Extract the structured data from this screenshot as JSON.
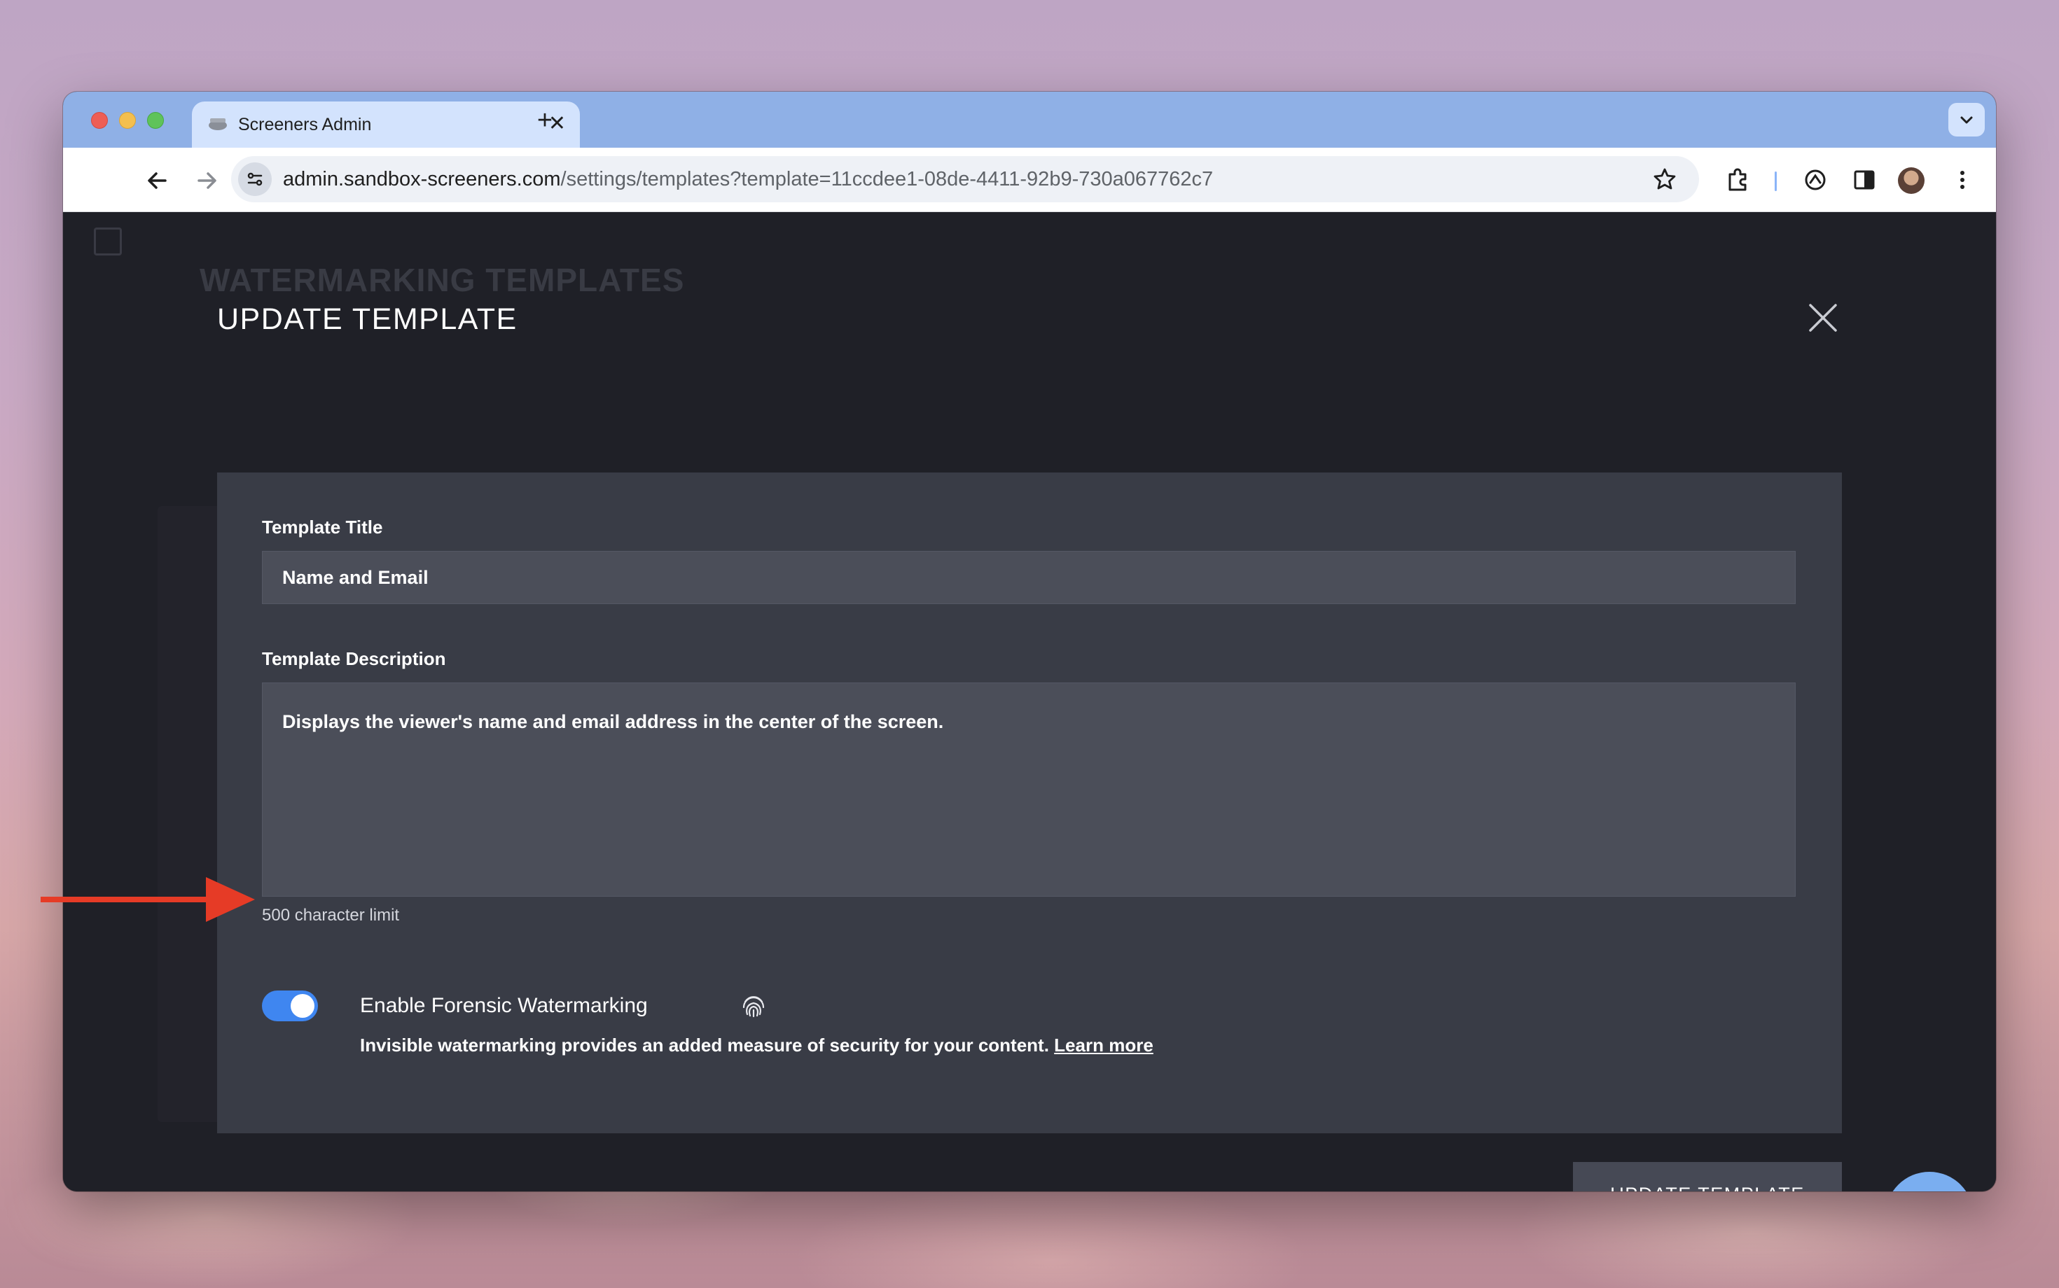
{
  "browser": {
    "tab_title": "Screeners Admin",
    "tab_close": "✕",
    "new_tab": "+",
    "url_host": "admin.sandbox-screeners.com",
    "url_path": "/settings/templates?template=11ccdee1-08de-4411-92b9-730a067762c7"
  },
  "background_page": {
    "title": "WATERMARKING TEMPLATES"
  },
  "modal": {
    "title": "UPDATE TEMPLATE",
    "title_field": {
      "label": "Template Title",
      "value": "Name and Email"
    },
    "description_field": {
      "label": "Template Description",
      "value": "Displays the viewer's name and email address in the center of the screen.",
      "helper": "500 character limit"
    },
    "forensic": {
      "enabled": true,
      "label": "Enable Forensic Watermarking",
      "description": "Invisible watermarking provides an added measure of security for your content.",
      "link": "Learn more"
    },
    "submit_label": "UPDATE TEMPLATE"
  },
  "colors": {
    "toggle_on": "#3f86f0",
    "arrow": "#e63b26",
    "tab_bar": "#8fb0e6",
    "modal_panel": "#393c46"
  }
}
